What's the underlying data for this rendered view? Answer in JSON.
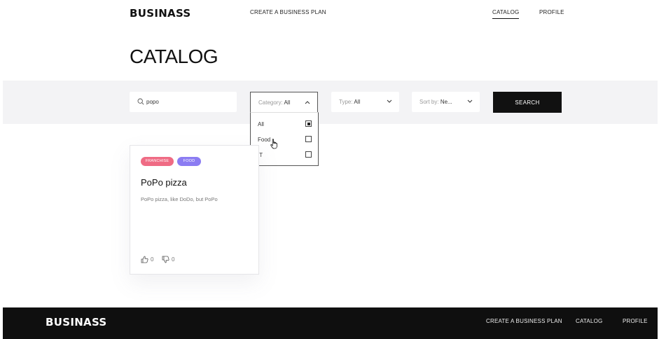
{
  "header": {
    "logo": "BUSINASS",
    "nav": {
      "create_plan": "CREATE A BUSINESS PLAN",
      "catalog": "CATALOG",
      "profile": "PROFILE"
    }
  },
  "page": {
    "title": "CATALOG"
  },
  "filters": {
    "search_value": "popo",
    "category": {
      "label": "Category:",
      "value": "All",
      "state": "open"
    },
    "type": {
      "label": "Type:",
      "value": "All"
    },
    "sort": {
      "label": "Sort by:",
      "value": "Ne..."
    },
    "search_button": "SEARCH"
  },
  "category_options": [
    {
      "label": "All",
      "checked": true
    },
    {
      "label": "Food",
      "checked": false
    },
    {
      "label": "IT",
      "checked": false
    }
  ],
  "cards": [
    {
      "tags": [
        "FRANCHISE",
        "FOOD"
      ],
      "title": "PoPo pizza",
      "description": "PoPo pizza, like DoDo, but PoPo",
      "likes": "0",
      "dislikes": "0"
    }
  ],
  "footer": {
    "logo": "BUSINASS",
    "nav": {
      "create_plan": "CREATE A BUSINESS PLAN",
      "catalog": "CATALOG",
      "profile": "PROFILE"
    }
  },
  "colors": {
    "accent_dark": "#111111",
    "tag_franchise": "#ef6b84",
    "tag_food": "#8b7cf2",
    "filter_band": "#f3f3f5"
  },
  "icons": {
    "search": "search-icon",
    "chevron_up": "chevron-up-icon",
    "chevron_down": "chevron-down-icon",
    "thumbs_up": "thumbs-up-icon",
    "thumbs_down": "thumbs-down-icon",
    "cursor": "hand-cursor-icon"
  }
}
